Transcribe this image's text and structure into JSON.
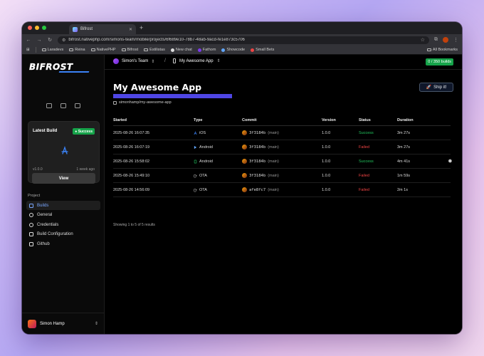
{
  "browser": {
    "tab_title": "Bifrost",
    "new_tab": "+",
    "url": "bifrost.nativephp.com/simons-team/mobile/projects/6f689e10-78b7-48ab-9acd-fe1e873c5706",
    "bookmarks": [
      "Laradevs",
      "Reina",
      "NativePHP",
      "Bifrost",
      "Estilistas",
      "New chat",
      "Fathom",
      "Showcode",
      "Small Bets"
    ],
    "all_bookmarks": "All Bookmarks",
    "traffic_colors": [
      "#ff5f57",
      "#febc2e",
      "#28c840"
    ]
  },
  "sidebar": {
    "logo": "BIFROST",
    "latest_build": {
      "title": "Latest Build",
      "status": "Success",
      "version": "v1.0.0",
      "time": "1 week ago",
      "view_label": "View"
    },
    "project_heading": "Project",
    "nav": [
      {
        "label": "Builds",
        "icon": "builds-icon",
        "active": true
      },
      {
        "label": "General",
        "icon": "gear-icon"
      },
      {
        "label": "Credentials",
        "icon": "key-icon"
      },
      {
        "label": "Build Configuration",
        "icon": "wrench-icon"
      },
      {
        "label": "Github",
        "icon": "github-icon"
      }
    ],
    "user_name": "Simon Hamp"
  },
  "topbar": {
    "team": "Simon's Team",
    "separator": "/",
    "project": "My Awesome App",
    "builds_badge": "0 / 350 builds"
  },
  "page": {
    "title": "My Awesome App",
    "progress": 1.0,
    "repo": "simonhamp/my-awesome-app",
    "ship_label": "Ship it!"
  },
  "table": {
    "headers": [
      "Started",
      "Type",
      "Commit",
      "Version",
      "Status",
      "Duration"
    ],
    "rows": [
      {
        "started": "2025-08-26 16:07:35",
        "type": "iOS",
        "icon": "ios-icon",
        "commit": "3f3184b",
        "branch": "(main)",
        "version": "1.0.0",
        "status": "Success",
        "duration": "3m 27s"
      },
      {
        "started": "2025-08-26 16:07:19",
        "type": "Android",
        "icon": "android-icon",
        "commit": "3f3184b",
        "branch": "(main)",
        "version": "1.0.0",
        "status": "Failed",
        "duration": "3m 27s"
      },
      {
        "started": "2025-08-26 15:58:02",
        "type": "Android",
        "icon": "android-phone-icon",
        "commit": "3f3184b",
        "branch": "(main)",
        "version": "1.0.0",
        "status": "Success",
        "duration": "4m 41s"
      },
      {
        "started": "2025-08-26 15:49:10",
        "type": "OTA",
        "icon": "ota-icon",
        "commit": "3f3184b",
        "branch": "(main)",
        "version": "1.0.0",
        "status": "Failed",
        "duration": "1m 59s"
      },
      {
        "started": "2025-08-26 14:56:09",
        "type": "OTA",
        "icon": "ota-icon",
        "commit": "afe8fc7",
        "branch": "(main)",
        "version": "1.0.0",
        "status": "Failed",
        "duration": "2m 1s"
      }
    ],
    "results": "Showing 1 to 5 of 5 results"
  },
  "colors": {
    "success": "#22c55e",
    "failed": "#ef4444",
    "accent": "#4f46e5",
    "badge": "#16a34a"
  }
}
